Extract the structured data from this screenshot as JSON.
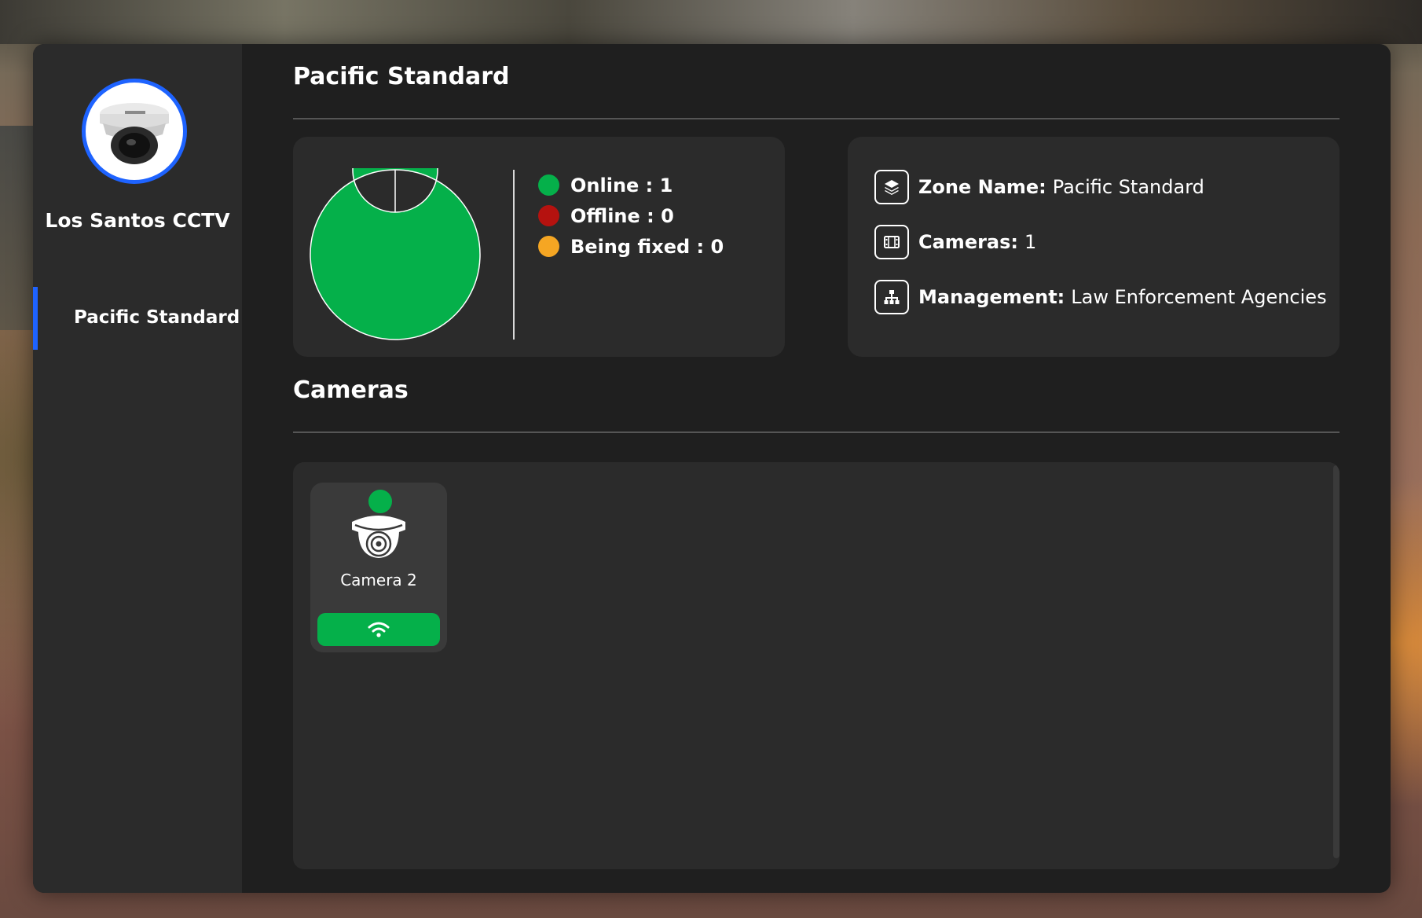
{
  "app": {
    "brand": "Los Santos CCTV"
  },
  "sidebar": {
    "items": [
      {
        "label": "Pacific Standard",
        "active": true
      }
    ]
  },
  "zone": {
    "title": "Pacific Standard"
  },
  "stats": {
    "online_label": "Online : 1",
    "offline_label": "Offline : 0",
    "fixing_label": "Being fixed : 0",
    "online": 1,
    "offline": 0,
    "being_fixed": 0,
    "colors": {
      "online": "#05b04a",
      "offline": "#b5120f",
      "being_fixed": "#f5a623"
    }
  },
  "info": {
    "zone_name_key": "Zone Name:",
    "zone_name_value": "Pacific Standard",
    "cameras_key": "Cameras:",
    "cameras_value": "1",
    "management_key": "Management:",
    "management_value": "Law Enforcement Agencies"
  },
  "cameras_section": {
    "title": "Cameras",
    "items": [
      {
        "name": "Camera 2",
        "status": "online",
        "icon": "dome-camera-icon",
        "action_icon": "wifi-icon"
      }
    ]
  },
  "theme": {
    "accent": "#1e63ff",
    "status_online": "#05b04a"
  }
}
